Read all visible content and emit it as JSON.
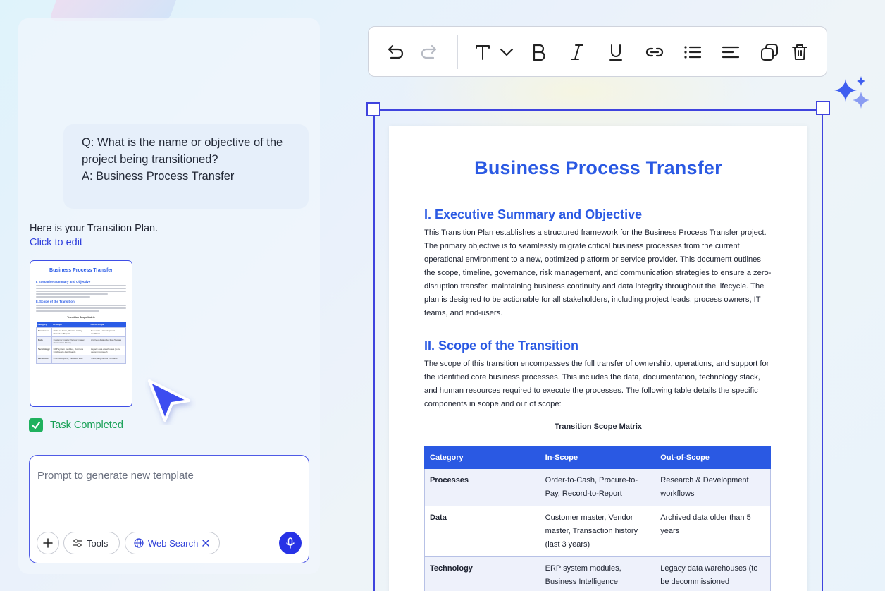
{
  "chat": {
    "qa_text": "Q: What is the name or objective of the\nproject being transitioned?\nA: Business Process Transfer",
    "intro": "Here is your Transition Plan.",
    "edit_link": "Click to edit",
    "thumbnail": {
      "title": "Business Process Transfer",
      "h1": "I. Executive Summary and Objective",
      "h2": "II. Scope of the Transition",
      "caption": "Transition Scope Matrix",
      "headers": [
        "Category",
        "In-Scope",
        "Out-of-Scope"
      ],
      "rows": [
        [
          "Processes",
          "Order-to-Cash, Procure-to-Pay, Record-to-Report",
          "Research & Development workflows"
        ],
        [
          "Data",
          "Customer master, Vendor master, Transaction history",
          "Archived data older than 5 years"
        ],
        [
          "Technology",
          "ERP system modules, Business Intelligence dashboards",
          "Legacy data warehouses (to be decommissioned)"
        ],
        [
          "Personnel",
          "Process experts, transition staff",
          "Third-party vendor contracts"
        ]
      ]
    },
    "task_status": "Task Completed",
    "status_color": "#1fb15e",
    "prompt_placeholder": "Prompt to generate new template",
    "tools_label": "Tools",
    "web_search_label": "Web Search"
  },
  "toolbar": {
    "buttons": [
      "undo-icon",
      "redo-icon",
      "text-style-icon",
      "chevron-down-icon",
      "bold-icon",
      "italic-icon",
      "underline-icon",
      "link-icon",
      "bullet-list-icon",
      "align-left-icon",
      "duplicate-icon",
      "delete-icon"
    ]
  },
  "document": {
    "title": "Business Process Transfer",
    "section1_heading": "I. Executive Summary and Objective",
    "section1_body": "This Transition Plan establishes a structured framework for the Business Process Transfer project. The primary objective is to seamlessly migrate critical business processes from the current operational environment to a new, optimized platform or service provider. This document outlines the scope, timeline, governance, risk management, and communication strategies to ensure a zero-disruption transfer, maintaining business continuity and data integrity throughout the lifecycle. The plan is designed to be actionable for all stakeholders, including project leads, process owners, IT teams, and end-users.",
    "section2_heading": "II. Scope of the Transition",
    "section2_body": "The scope of this transition encompasses the full transfer of ownership, operations, and support for the identified core business processes. This includes the data, documentation, technology stack, and human resources required to execute the processes. The following table details the specific components in scope and out of scope:",
    "table_caption": "Transition Scope Matrix",
    "table_headers": [
      "Category",
      "In-Scope",
      "Out-of-Scope"
    ],
    "table_rows": [
      [
        "Processes",
        "Order-to-Cash, Procure-to-Pay, Record-to-Report",
        "Research & Development workflows"
      ],
      [
        "Data",
        "Customer master, Vendor master, Transaction history (last 3 years)",
        "Archived data older than 5 years"
      ],
      [
        "Technology",
        "ERP system modules, Business Intelligence",
        "Legacy data warehouses (to be decommissioned"
      ]
    ],
    "accent_color": "#2a59e3"
  }
}
